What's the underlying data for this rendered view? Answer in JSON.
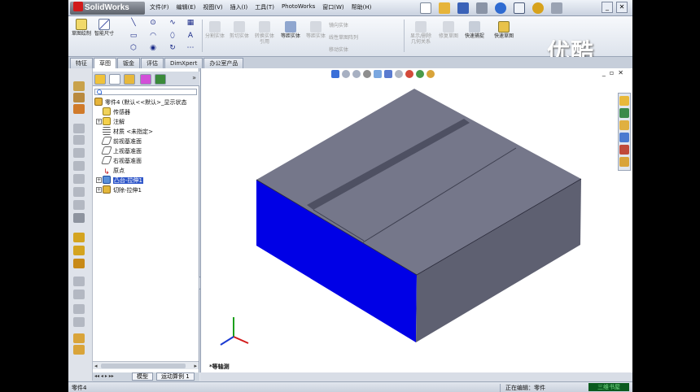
{
  "app": {
    "logo": "SolidWorks"
  },
  "menu": [
    "文件(F)",
    "编辑(E)",
    "视图(V)",
    "插入(I)",
    "工具(T)",
    "PhotoWorks",
    "窗口(W)",
    "帮助(H)"
  ],
  "quick_access_icons": [
    "new-doc-icon",
    "open-icon",
    "save-icon",
    "print-icon",
    "undo-icon",
    "select-icon",
    "rebuild-icon",
    "options-icon"
  ],
  "watermark": "优酷",
  "ribbon": {
    "sketch": "草图绘制",
    "smart_dim": "智能尺寸",
    "commands": [
      "分割实体",
      "剪切实体",
      "转换实体引用",
      "等距实体",
      "等距实体",
      "显示/删除几何关系",
      "修复草图",
      "快速捕捉",
      "快速草图"
    ],
    "mirror": "镜向实体",
    "linear_array": "线性草图阵列",
    "move": "移动实体"
  },
  "command_tabs": [
    "特征",
    "草图",
    "钣金",
    "评估",
    "DimXpert",
    "办公室产品"
  ],
  "active_command_tab": "草图",
  "tree": {
    "root": "零件4  (默认<<默认>_显示状态",
    "items": [
      {
        "label": "传感器",
        "icon": "sensor-icon"
      },
      {
        "label": "注解",
        "icon": "annotation-icon"
      },
      {
        "label": "材质 <未指定>",
        "icon": "material-icon"
      },
      {
        "label": "前视基准面",
        "icon": "plane-icon"
      },
      {
        "label": "上视基准面",
        "icon": "plane-icon"
      },
      {
        "label": "右视基准面",
        "icon": "plane-icon"
      },
      {
        "label": "原点",
        "icon": "origin-icon"
      },
      {
        "label": "凸台-拉伸1",
        "icon": "extrude-icon",
        "selected": true
      },
      {
        "label": "切除-拉伸1",
        "icon": "cut-extrude-icon"
      }
    ]
  },
  "bottom_tabs": [
    "模型",
    "运动算例 1"
  ],
  "active_bottom_tab": "模型",
  "view_name": "*等轴测",
  "status": {
    "left": "零件4",
    "editing": "正在编辑：零件",
    "brand": "三维书屋"
  },
  "colors": {
    "model_top": "#75778a",
    "model_right": "#5e6071",
    "model_front": "#0000e6",
    "accent": "#2d55c9"
  }
}
